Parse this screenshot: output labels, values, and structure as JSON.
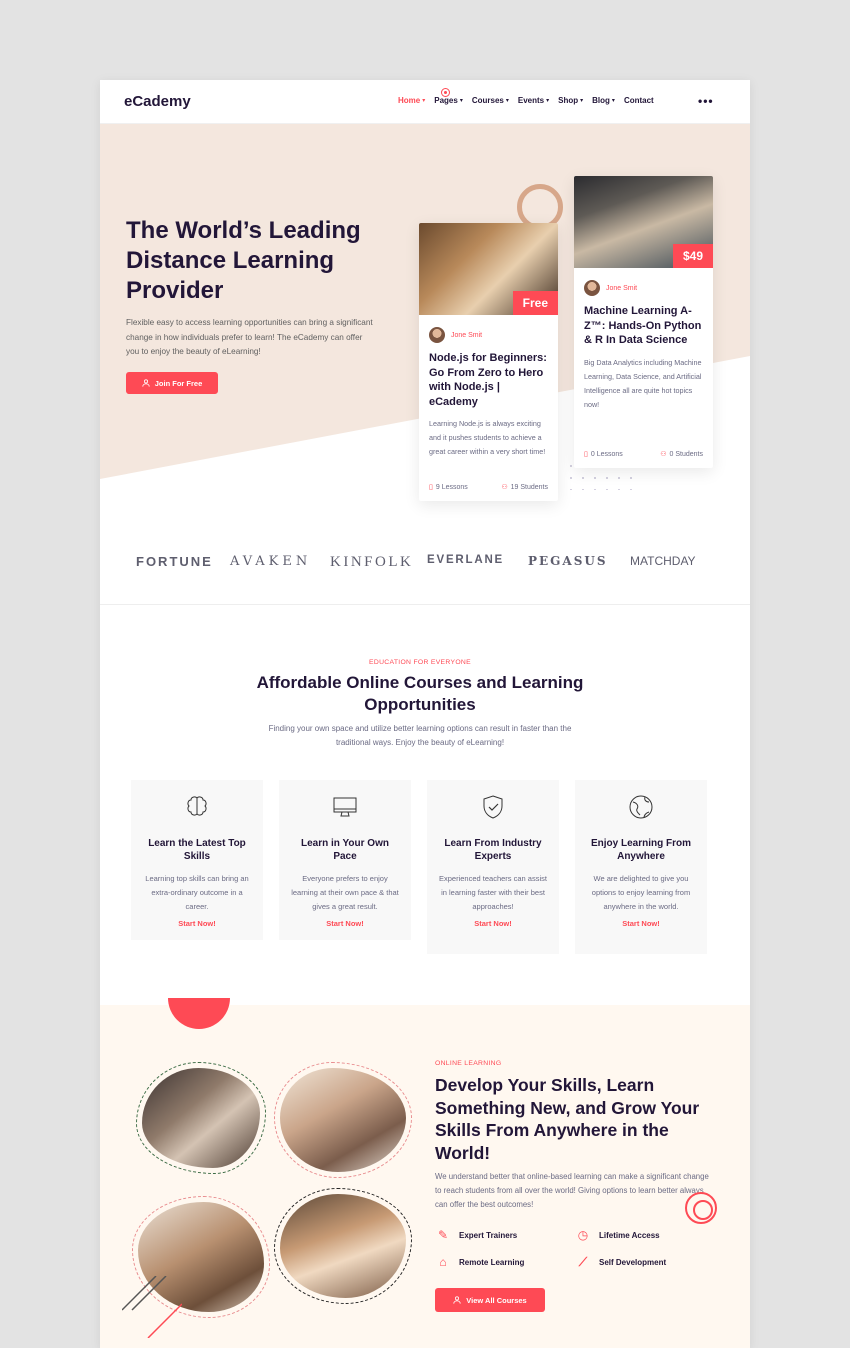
{
  "header": {
    "logo": "eCademy",
    "menu": [
      {
        "label": "Home",
        "dropdown": true,
        "active": true
      },
      {
        "label": "Pages",
        "dropdown": true
      },
      {
        "label": "Courses",
        "dropdown": true
      },
      {
        "label": "Events",
        "dropdown": true
      },
      {
        "label": "Shop",
        "dropdown": true
      },
      {
        "label": "Blog",
        "dropdown": true
      },
      {
        "label": "Contact",
        "dropdown": false
      }
    ],
    "more_icon": "•••"
  },
  "hero": {
    "title": "The World’s Leading Distance Learning Provider",
    "description": "Flexible easy to access learning opportunities can bring a significant change in how individuals prefer to learn! The eCademy can offer you to enjoy the beauty of eLearning!",
    "button_label": "Join For Free",
    "cards": [
      {
        "price": "Free",
        "author": "Jone Smit",
        "title": "Node.js for Beginners: Go From Zero to Hero with Node.js | eCademy",
        "description": "Learning Node.js is always exciting and it pushes students to achieve a great career within a very short time!",
        "lessons": "9 Lessons",
        "students": "19 Students"
      },
      {
        "price": "$49",
        "author": "Jone Smit",
        "title": "Machine Learning A-Z™: Hands-On Python & R In Data Science",
        "description": "Big Data Analytics including Machine Learning, Data Science, and Artificial Intelligence all are quite hot topics now!",
        "lessons": "0 Lessons",
        "students": "0 Students"
      }
    ]
  },
  "partners": [
    "FORTUNE",
    "AVAKEN",
    "KINFOLK",
    "EVERLANE",
    "PEGASUS",
    "MATCHDAY"
  ],
  "section2": {
    "eyebrow": "EDUCATION FOR EVERYONE",
    "title": "Affordable Online Courses and Learning Opportunities",
    "description": "Finding your own space and utilize better learning options can result in faster than the traditional ways. Enjoy the beauty of eLearning!",
    "features": [
      {
        "icon": "brain-icon",
        "title": "Learn the Latest Top Skills",
        "description": "Learning top skills can bring an extra-ordinary outcome in a career.",
        "link": "Start Now!"
      },
      {
        "icon": "monitor-icon",
        "title": "Learn in Your Own Pace",
        "description": "Everyone prefers to enjoy learning at their own pace & that gives a great result.",
        "link": "Start Now!"
      },
      {
        "icon": "shield-check-icon",
        "title": "Learn From Industry Experts",
        "description": "Experienced teachers can assist in learning faster with their best approaches!",
        "link": "Start Now!"
      },
      {
        "icon": "globe-icon",
        "title": "Enjoy Learning From Anywhere",
        "description": "We are delighted to give you options to enjoy learning from anywhere in the world.",
        "link": "Start Now!"
      }
    ]
  },
  "section3": {
    "eyebrow": "ONLINE LEARNING",
    "title": "Develop Your Skills, Learn Something New, and Grow Your Skills From Anywhere in the World!",
    "description": "We understand better that online-based learning can make a significant change to reach students from all over the world! Giving options to learn better always can offer the best outcomes!",
    "features": [
      {
        "icon": "trainer-icon",
        "label": "Expert Trainers"
      },
      {
        "icon": "clock-icon",
        "label": "Lifetime Access"
      },
      {
        "icon": "remote-icon",
        "label": "Remote Learning"
      },
      {
        "icon": "growth-icon",
        "label": "Self Development"
      }
    ],
    "button_label": "View All Courses"
  },
  "colors": {
    "accent": "#fe4a55",
    "heading": "#221638",
    "hero_bg": "#f4e7de",
    "section3_bg": "#fff8f0"
  }
}
